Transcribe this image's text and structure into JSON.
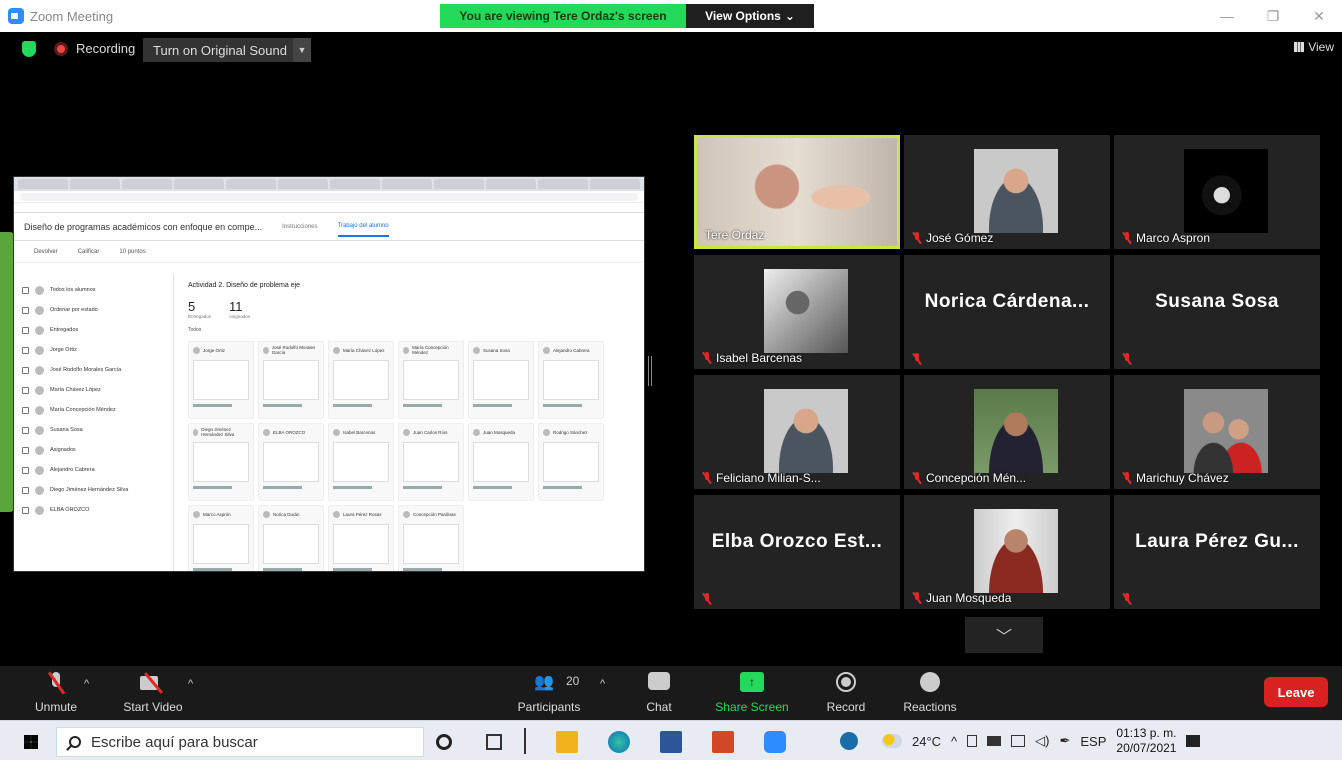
{
  "window": {
    "title": "Zoom Meeting",
    "viewing_banner": "You are viewing Tere Ordaz's screen",
    "view_options": "View Options",
    "minimize": "—",
    "restore": "❐",
    "close": "✕"
  },
  "topbar": {
    "recording": "Recording",
    "original_sound": "Turn on Original Sound",
    "view": "View"
  },
  "shared_screen": {
    "class_title": "Diseño de programas académicos con enfoque en compe...",
    "tabs": [
      "Instrucciones",
      "Trabajo del alumno"
    ],
    "toolbar": [
      "Devolver",
      "Calificar",
      "10 puntos"
    ],
    "activity_title": "Actividad 2. Diseño de problema eje",
    "submitted_count": "5",
    "submitted_label": "Entregados",
    "assigned_count": "11",
    "assigned_label": "Asignados",
    "filter": "Todos",
    "side_rows": [
      "Todos los alumnos",
      "Ordenar por estado",
      "Entregados",
      "Jorge Ortiz",
      "José Rodolfo Morales García",
      "María Chávez López",
      "María Concepción Méndez",
      "Susana Sosa",
      "Asignados",
      "Alejandro Cabrera",
      "Diego Jiménez Hernández Silva",
      "ELBA OROZCO"
    ],
    "cards": [
      "Jorge Ortiz",
      "José Rodolfo Morales García",
      "María Chávez López",
      "María Concepción Méndez",
      "Susana Sosa",
      "Alejandro Cabrera",
      "Diego Jiménez Hernández Silva",
      "ELBA OROZCO",
      "Isabel Barcenas",
      "Juan Carlos Ríos",
      "Juan Mosqueda",
      "Rodrigo Sánchez",
      "Marco Asprón",
      "Norica Durán",
      "Laura Pérez Rosas",
      "Concepción Pardinas"
    ]
  },
  "participants": [
    {
      "name": "Tere Ordaz",
      "active": true,
      "muted": false
    },
    {
      "name": "José Gómez",
      "active": false,
      "muted": true
    },
    {
      "name": "Marco Aspron",
      "active": false,
      "muted": true
    },
    {
      "name": "Isabel Barcenas",
      "active": false,
      "muted": true
    },
    {
      "name": "Norica  Cárdena...",
      "active": false,
      "muted": true
    },
    {
      "name": "Susana Sosa",
      "active": false,
      "muted": true
    },
    {
      "name": "Feliciano Milian-S...",
      "active": false,
      "muted": true
    },
    {
      "name": "Concepción Mén...",
      "active": false,
      "muted": true
    },
    {
      "name": "Marichuy Chávez",
      "active": false,
      "muted": true
    },
    {
      "name": "Elba Orozco Est...",
      "active": false,
      "muted": true
    },
    {
      "name": "Juan Mosqueda",
      "active": false,
      "muted": true
    },
    {
      "name": "Laura Pérez Gu...",
      "active": false,
      "muted": true
    }
  ],
  "toolbar": {
    "unmute": "Unmute",
    "start_video": "Start Video",
    "participants": "Participants",
    "participants_count": "20",
    "chat": "Chat",
    "share_screen": "Share Screen",
    "record": "Record",
    "reactions": "Reactions",
    "leave": "Leave",
    "caret": "^",
    "expand": "﹀"
  },
  "taskbar": {
    "search_placeholder": "Escribe aquí para buscar",
    "weather": "24°C",
    "language": "ESP",
    "time": "01:13 p. m.",
    "date": "20/07/2021"
  },
  "colors": {
    "banner_green": "#23d959",
    "active_speaker": "#c8e64a",
    "leave_red": "#d92121",
    "zoom_blue": "#2d8cff"
  }
}
